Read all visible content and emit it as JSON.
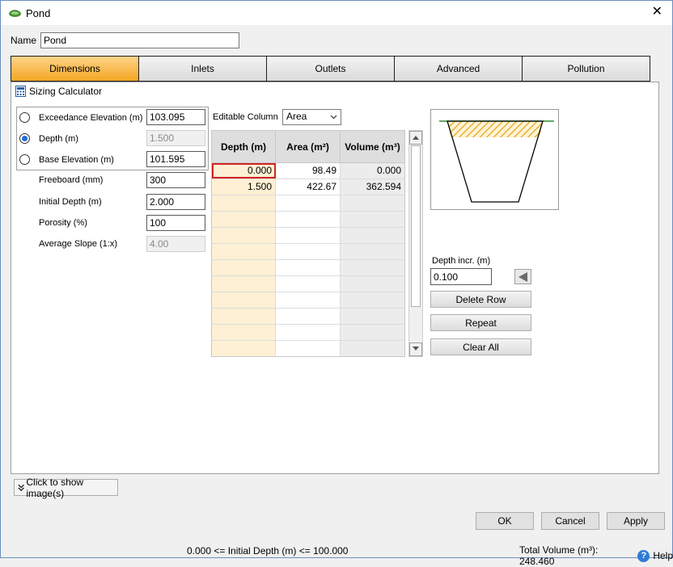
{
  "window": {
    "title": "Pond",
    "close_glyph": "✕"
  },
  "name_field": {
    "label": "Name",
    "value": "Pond"
  },
  "tabs": [
    {
      "label": "Dimensions",
      "active": true
    },
    {
      "label": "Inlets",
      "active": false
    },
    {
      "label": "Outlets",
      "active": false
    },
    {
      "label": "Advanced",
      "active": false
    },
    {
      "label": "Pollution",
      "active": false
    }
  ],
  "sizing": {
    "label": "Sizing Calculator"
  },
  "parameters": {
    "exceedance": {
      "label": "Exceedance Elevation (m)",
      "value": "103.095"
    },
    "depth": {
      "label": "Depth (m)",
      "value": "1.500"
    },
    "base": {
      "label": "Base Elevation (m)",
      "value": "101.595"
    },
    "freeboard": {
      "label": "Freeboard (mm)",
      "value": "300"
    },
    "initial_depth": {
      "label": "Initial Depth (m)",
      "value": "2.000"
    },
    "porosity": {
      "label": "Porosity (%)",
      "value": "100"
    },
    "avg_slope": {
      "label": "Average Slope (1:x)",
      "value": "4.00"
    }
  },
  "editable_column": {
    "label": "Editable Column",
    "value": "Area"
  },
  "table": {
    "headers": [
      "Depth (m)",
      "Area (m²)",
      "Volume (m³)"
    ],
    "rows": [
      [
        "0.000",
        "98.49",
        "0.000"
      ],
      [
        "1.500",
        "422.67",
        "362.594"
      ]
    ]
  },
  "depth_incr": {
    "label": "Depth incr. (m)",
    "value": "0.100"
  },
  "buttons": {
    "delete_row": "Delete Row",
    "repeat": "Repeat",
    "clear_all": "Clear All",
    "show_images": "Click to show image(s)",
    "ok": "OK",
    "cancel": "Cancel",
    "apply": "Apply",
    "help": "Help"
  },
  "status": {
    "left": "0.000 <= Initial Depth (m) <= 100.000",
    "right": "Total Volume (m³): 248.460"
  },
  "colors": {
    "tab_active": "#f5a623",
    "depth_column": "#fdf0d4",
    "selected_border": "#d22222",
    "help_icon": "#2e7bd6"
  }
}
